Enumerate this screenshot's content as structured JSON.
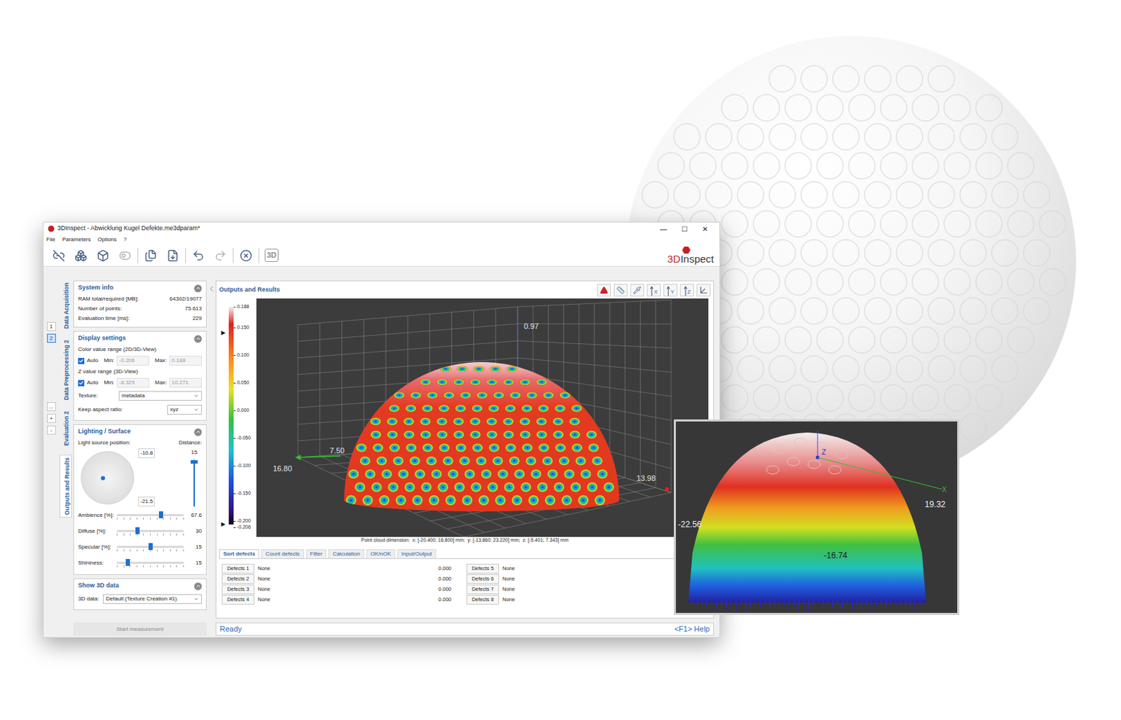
{
  "window": {
    "title": "3DInspect - Abwicklung Kugel Defekte.me3dparam*",
    "controls": [
      "—",
      "☐",
      "✕"
    ]
  },
  "menu": [
    "File",
    "Parameters",
    "Options",
    "?"
  ],
  "toolbar": [
    {
      "disabled": false,
      "label": ""
    },
    {
      "disabled": false,
      "label": ""
    },
    {
      "disabled": false,
      "label": ""
    },
    {
      "disabled": true,
      "label": ""
    },
    {
      "disabled": false,
      "label": ""
    },
    {
      "disabled": false,
      "label": ""
    },
    {
      "disabled": false,
      "label": ""
    },
    {
      "disabled": true,
      "label": ""
    },
    {
      "disabled": false,
      "label": ""
    },
    {
      "disabled": false,
      "label": "3D"
    }
  ],
  "logo": {
    "accent": "3D",
    "text": "Inspect"
  },
  "pages": [
    {
      "label": "1",
      "selected": false
    },
    {
      "label": "2",
      "selected": true
    }
  ],
  "page_actions": [
    "...",
    "+",
    "-"
  ],
  "side_tabs": [
    {
      "label": "Data Acquisition",
      "selected": false
    },
    {
      "label": "Data Preprocessing 2",
      "selected": false
    },
    {
      "label": "Evaluation 2",
      "selected": false
    },
    {
      "label": "Outputs and Results",
      "selected": true
    }
  ],
  "system_info": {
    "title": "System info",
    "rows": [
      {
        "label": "RAM total/required [MB]:",
        "value": "64302/19077"
      },
      {
        "label": "Number of points:",
        "value": "75.613"
      },
      {
        "label": "Evaluation time [ms]:",
        "value": "229"
      }
    ]
  },
  "display_settings": {
    "title": "Display settings",
    "ranges": [
      {
        "label": "Color value range (2D/3D-View)",
        "auto_label": "Auto",
        "auto": true,
        "min_label": "Min:",
        "min": "-0.206",
        "max_label": "Max:",
        "max": "0.188"
      },
      {
        "label": "Z value range (3D-View)",
        "auto_label": "Auto",
        "auto": true,
        "min_label": "Min:",
        "min": "-8.329",
        "max_label": "Max:",
        "max": "10.271"
      }
    ],
    "texture": {
      "label": "Texture:",
      "value": "metadata"
    },
    "aspect": {
      "label": "Keep aspect ratio:",
      "value": "xyz"
    }
  },
  "lighting": {
    "title": "Lighting / Surface",
    "light_label": "Light source position:",
    "distance_label": "Distance:",
    "x": "-10.8",
    "y": "-21.5",
    "dot": {
      "x": 0.41,
      "y": 0.5
    },
    "distance": "15",
    "distance_level": 0.93,
    "sliders": [
      {
        "label": "Ambience [%]:",
        "value": "67.6",
        "level": 0.66
      },
      {
        "label": "Diffuse [%]:",
        "value": "30",
        "level": 0.31
      },
      {
        "label": "Specular [%]:",
        "value": "15",
        "level": 0.5
      },
      {
        "label": "Shininess:",
        "value": "15",
        "level": 0.17
      }
    ]
  },
  "show_3d": {
    "title": "Show 3D data",
    "label": "3D data:",
    "value": "Default (Texture Creation #1)"
  },
  "start_button": {
    "label": "Start measurement",
    "disabled": true
  },
  "results": {
    "title": "Outputs and Results",
    "axes": [
      "X",
      "Y",
      "Z"
    ],
    "marker": "▶",
    "colorbar": [
      "0.188",
      "0.150",
      "0.100",
      "0.050",
      "0.000",
      "-0.050",
      "-0.100",
      "-0.150",
      "-0.200",
      "-0.206"
    ],
    "labels": {
      "top": "0.97",
      "left_near": "7.50",
      "left_far": "16.80",
      "right": "13.98"
    },
    "dimension": "Point cloud dimension:  x: [-20.400; 16.800] mm;  y: [-13.860; 23.220] mm;  z: [-5.401; 7.343] mm"
  },
  "tabs": [
    {
      "label": "Sort defects",
      "selected": true
    },
    {
      "label": "Count defects",
      "selected": false
    },
    {
      "label": "Filter",
      "selected": false
    },
    {
      "label": "Calculation",
      "selected": false
    },
    {
      "label": "OK/nOK",
      "selected": false
    },
    {
      "label": "Input/Output",
      "selected": false
    }
  ],
  "defects": [
    {
      "label": "Defects 1",
      "value": "None",
      "number": "0.000"
    },
    {
      "label": "Defects 5",
      "value": "None",
      "number": ""
    },
    {
      "label": "Defects 2",
      "value": "None",
      "number": "0.000"
    },
    {
      "label": "Defects 6",
      "value": "None",
      "number": ""
    },
    {
      "label": "Defects 3",
      "value": "None",
      "number": "0.000"
    },
    {
      "label": "Defects 7",
      "value": "None",
      "number": ""
    },
    {
      "label": "Defects 4",
      "value": "None",
      "number": "0.000"
    },
    {
      "label": "Defects 8",
      "value": "None",
      "number": ""
    }
  ],
  "status_bar": {
    "text": "Ready",
    "help": "<F1> Help"
  },
  "inset": {
    "z": "Z",
    "x": "X",
    "right": "19.32",
    "left": "-22.56",
    "front": "-16.74"
  }
}
